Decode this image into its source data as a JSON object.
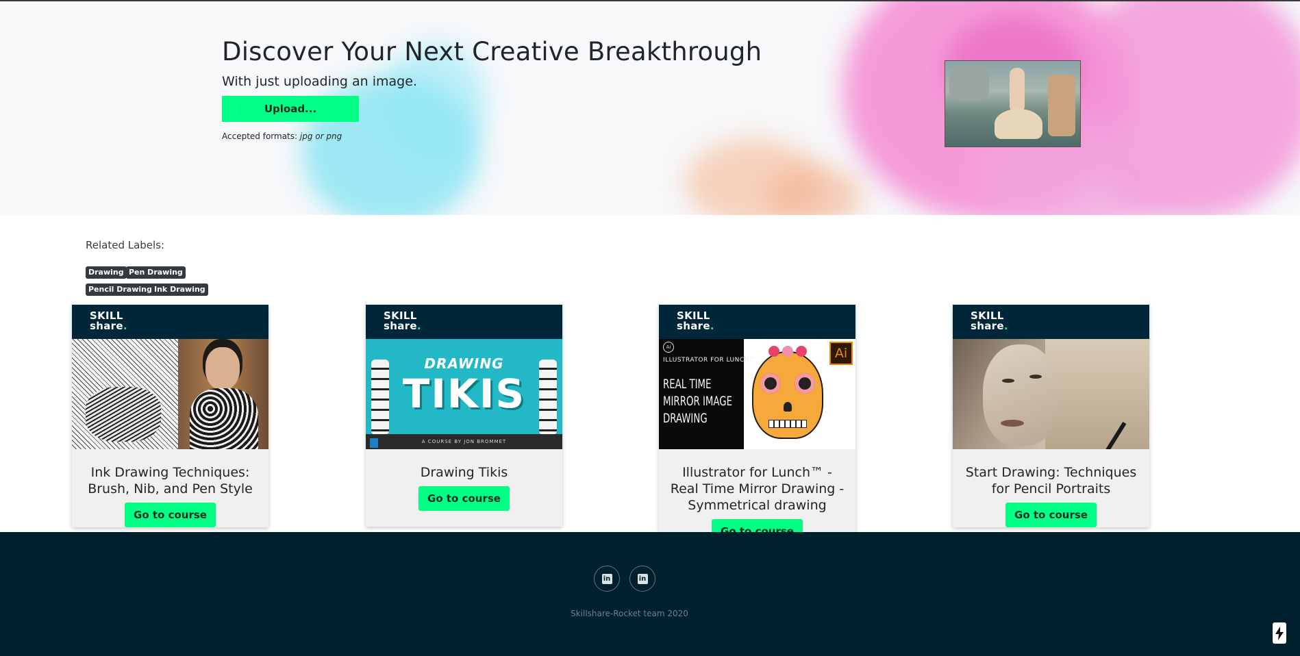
{
  "hero": {
    "title": "Discover Your Next Creative Breakthrough",
    "subtitle": "With just uploading an image.",
    "upload_label": "Upload...",
    "formats_prefix": "Accepted formats:",
    "formats_value": "jpg or png"
  },
  "labels": {
    "title": "Related Labels:",
    "items": [
      "Drawing",
      "Pen Drawing",
      "Pencil Drawing",
      "Ink Drawing"
    ]
  },
  "courses": [
    {
      "brand": "SKILL share.",
      "title": "Ink Drawing Techniques: Brush, Nib, and Pen Style",
      "button": "Go to course"
    },
    {
      "brand": "SKILL share.",
      "title": "Drawing Tikis",
      "button": "Go to course",
      "thumb_text": [
        "DRAWING",
        "TIKIS",
        "A COURSE BY JON BROMMET"
      ]
    },
    {
      "brand": "SKILL share.",
      "title": "Illustrator for Lunch™ - Real Time Mirror Drawing - Symmetrical drawing",
      "button": "Go to course",
      "thumb_text": [
        "ILLUSTRATOR FOR LUNCH™",
        "REAL TIME",
        "MIRROR IMAGE",
        "DRAWING",
        "Ai"
      ]
    },
    {
      "brand": "SKILL share.",
      "title": "Start Drawing: Techniques for Pencil Portraits",
      "button": "Go to course"
    }
  ],
  "footer": {
    "social": [
      "linkedin-icon",
      "linkedin-icon"
    ],
    "copyright": "Skillshare-Rocket team 2020"
  },
  "colors": {
    "accent": "#00ff84",
    "footer_bg": "#00202e",
    "card_header": "#00263a",
    "badge_bg": "#343a40"
  }
}
